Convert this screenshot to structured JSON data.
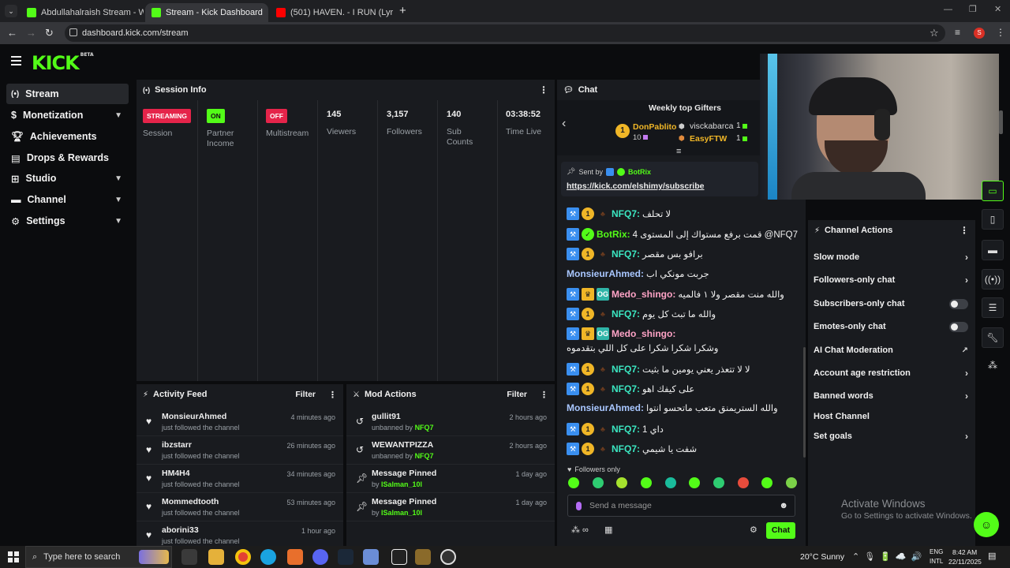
{
  "browser": {
    "tabs": [
      {
        "title": "Abdullahalraish Stream - Watc",
        "favicon_color": "#53fc18",
        "active": false
      },
      {
        "title": "Stream - Kick Dashboard",
        "favicon_color": "#53fc18",
        "active": true
      },
      {
        "title": "(501) HAVEN. - I RUN (Lyrics) -",
        "favicon_color": "#ff0000",
        "active": false
      }
    ],
    "url": "dashboard.kick.com/stream",
    "new_tab": "+",
    "profile_initial": "S"
  },
  "app": {
    "logo": "KICK",
    "logo_badge": "BETA",
    "accent": "#53fc18"
  },
  "sidebar": {
    "items": [
      {
        "label": "Stream",
        "icon": "broadcast-icon",
        "expandable": false,
        "active": true
      },
      {
        "label": "Monetization",
        "icon": "dollar-icon",
        "expandable": true
      },
      {
        "label": "Achievements",
        "icon": "trophy-icon",
        "expandable": false
      },
      {
        "label": "Drops & Rewards",
        "icon": "gift-icon",
        "expandable": false
      },
      {
        "label": "Studio",
        "icon": "studio-icon",
        "expandable": true
      },
      {
        "label": "Channel",
        "icon": "channel-icon",
        "expandable": true
      },
      {
        "label": "Settings",
        "icon": "gear-icon",
        "expandable": true
      }
    ]
  },
  "session": {
    "title": "Session Info",
    "stats": [
      {
        "badge": "STREAMING",
        "label": "Session",
        "badge_color": "#e5244a"
      },
      {
        "badge": "ON",
        "label": "Partner Income",
        "badge_color": "#53fc18"
      },
      {
        "badge": "OFF",
        "label": "Multistream",
        "badge_color": "#e5244a"
      },
      {
        "value": "145",
        "label": "Viewers"
      },
      {
        "value": "3,157",
        "label": "Followers"
      },
      {
        "value": "140",
        "label": "Sub Counts"
      },
      {
        "value": "03:38:52",
        "label": "Time Live"
      }
    ]
  },
  "activity": {
    "title": "Activity Feed",
    "filter": "Filter",
    "items": [
      {
        "name": "MonsieurAhmed",
        "sub": "just followed the channel",
        "time": "4 minutes ago"
      },
      {
        "name": "ibzstarr",
        "sub": "just followed the channel",
        "time": "26 minutes ago"
      },
      {
        "name": "HM4H4",
        "sub": "just followed the channel",
        "time": "34 minutes ago"
      },
      {
        "name": "Mommedtooth",
        "sub": "just followed the channel",
        "time": "53 minutes ago"
      },
      {
        "name": "aborini33",
        "sub": "just followed the channel",
        "time": "1 hour ago"
      }
    ]
  },
  "mod": {
    "title": "Mod Actions",
    "filter": "Filter",
    "items": [
      {
        "name": "gullit91",
        "sub": "unbanned by",
        "by": "NFQ7",
        "time": "2 hours ago",
        "icon": "undo-icon"
      },
      {
        "name": "WEWANTPIZZA",
        "sub": "unbanned by",
        "by": "NFQ7",
        "time": "2 hours ago",
        "icon": "undo-icon"
      },
      {
        "name": "Message Pinned",
        "sub": "by",
        "by": "ISalman_10l",
        "time": "1 day ago",
        "icon": "pin-icon"
      },
      {
        "name": "Message Pinned",
        "sub": "by",
        "by": "ISalman_10l",
        "time": "1 day ago",
        "icon": "pin-icon"
      }
    ]
  },
  "chat": {
    "title": "Chat",
    "gifters_title": "Weekly top Gifters",
    "gifters": [
      {
        "rank": "1",
        "name": "DonPablito",
        "count": "10"
      },
      {
        "name": "visckabarca",
        "count": "1"
      },
      {
        "name": "EasyFTW",
        "count": "1"
      }
    ],
    "pinned": {
      "sent_by": "Sent by",
      "author": "BotRix",
      "link": "https://kick.com/elshimy/subscribe"
    },
    "messages": [
      {
        "user": "NFQ7",
        "color": "#3be6c1",
        "text": "لا تحلف",
        "badges": [
          "mod",
          "sub",
          "gifter"
        ]
      },
      {
        "user": "BotRix",
        "color": "#53fc18",
        "text": "قمت برفع مستواك إلى المستوى 4 @NFQ7",
        "badges": [
          "mod",
          "verified"
        ]
      },
      {
        "user": "NFQ7",
        "color": "#3be6c1",
        "text": "برافو بس مقصر",
        "badges": [
          "mod",
          "sub",
          "gifter"
        ]
      },
      {
        "user": "MonsieurAhmed",
        "color": "#a9c7ff",
        "text": "جربت مونكي اب",
        "badges": []
      },
      {
        "user": "Medo_shingo",
        "color": "#ffa3c6",
        "text": "والله منت مقصر ولا ١ فالميه",
        "badges": [
          "mod",
          "crown",
          "og"
        ]
      },
      {
        "user": "NFQ7",
        "color": "#3be6c1",
        "text": "والله ما تبث كل يوم",
        "badges": [
          "mod",
          "sub",
          "gifter"
        ]
      },
      {
        "user": "Medo_shingo",
        "color": "#ffa3c6",
        "text": "وشكرا شكرا شكرا على كل اللي بتقدموه",
        "badges": [
          "mod",
          "crown",
          "og"
        ]
      },
      {
        "user": "NFQ7",
        "color": "#3be6c1",
        "text": "لا لا تتعذر يعني يومين ما بثيت",
        "badges": [
          "mod",
          "sub",
          "gifter"
        ]
      },
      {
        "user": "NFQ7",
        "color": "#3be6c1",
        "text": "على كيفك اهو",
        "badges": [
          "mod",
          "sub",
          "gifter"
        ]
      },
      {
        "user": "MonsieurAhmed",
        "color": "#a9c7ff",
        "text": "والله الستريمنق متعب ماتحسو انتوا",
        "badges": []
      },
      {
        "user": "NFQ7",
        "color": "#3be6c1",
        "text": "داي 1",
        "badges": [
          "mod",
          "sub",
          "gifter"
        ]
      },
      {
        "user": "NFQ7",
        "color": "#3be6c1",
        "text": "شفت يا شيمي",
        "badges": [
          "mod",
          "sub",
          "gifter"
        ]
      }
    ],
    "followers_only": "Followers only",
    "input_placeholder": "Send a message",
    "send_label": "Chat"
  },
  "channel_actions": {
    "title": "Channel Actions",
    "items": [
      {
        "label": "Slow mode",
        "control": "chevron"
      },
      {
        "label": "Followers-only chat",
        "control": "chevron"
      },
      {
        "label": "Subscribers-only chat",
        "control": "toggle"
      },
      {
        "label": "Emotes-only chat",
        "control": "toggle"
      },
      {
        "label": "AI Chat Moderation",
        "control": "external"
      },
      {
        "label": "Account age restriction",
        "control": "chevron"
      },
      {
        "label": "Banned words",
        "control": "chevron"
      },
      {
        "label": "Host Channel",
        "control": "none"
      },
      {
        "label": "Set goals",
        "control": "chevron"
      }
    ]
  },
  "windows_watermark": {
    "title": "Activate Windows",
    "sub": "Go to Settings to activate Windows."
  },
  "taskbar": {
    "search_placeholder": "Type here to search",
    "weather": "20°C  Sunny",
    "lang_top": "ENG",
    "lang_bottom": "INTL",
    "time": "8:42 AM",
    "date": "22/11/2025"
  }
}
